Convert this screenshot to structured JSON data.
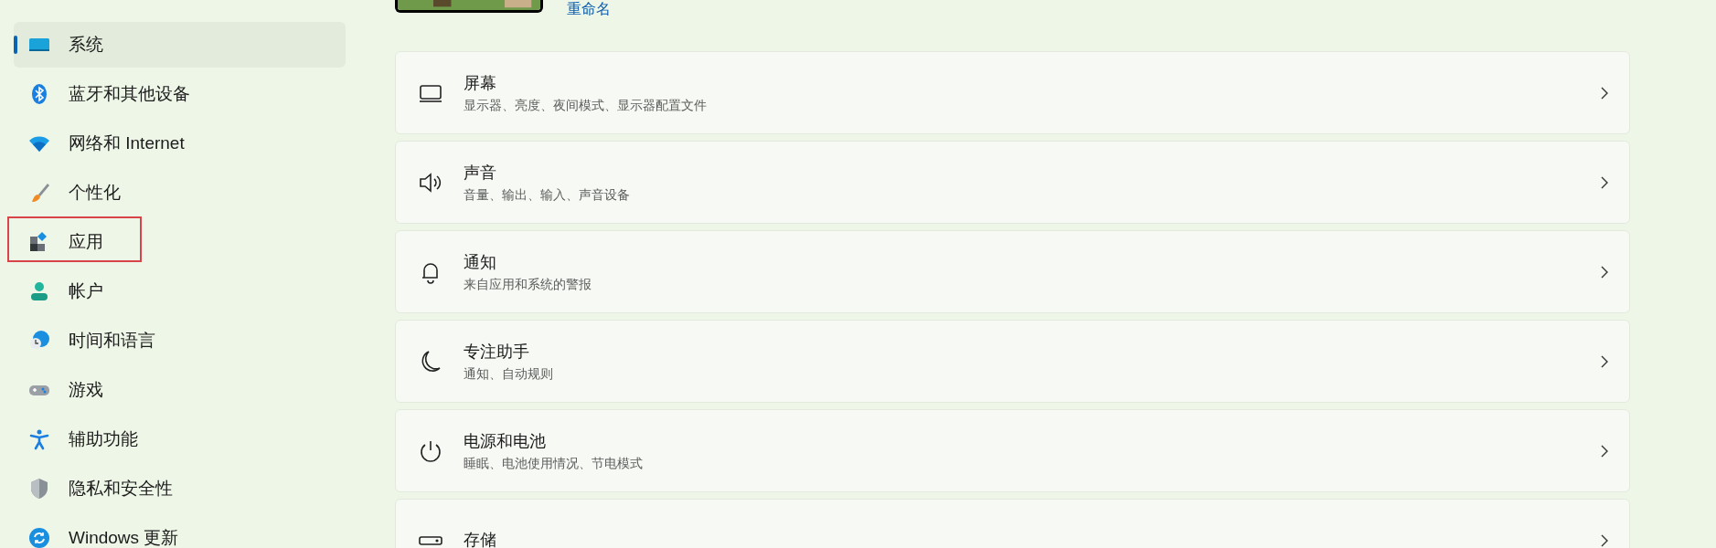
{
  "device": {
    "rename_link": "重命名"
  },
  "sidebar": {
    "items": [
      {
        "label": "系统",
        "kind": "system",
        "selected": true,
        "highlighted": false
      },
      {
        "label": "蓝牙和其他设备",
        "kind": "bluetooth",
        "selected": false,
        "highlighted": false
      },
      {
        "label": "网络和 Internet",
        "kind": "network",
        "selected": false,
        "highlighted": false
      },
      {
        "label": "个性化",
        "kind": "personalize",
        "selected": false,
        "highlighted": false
      },
      {
        "label": "应用",
        "kind": "apps",
        "selected": false,
        "highlighted": true
      },
      {
        "label": "帐户",
        "kind": "account",
        "selected": false,
        "highlighted": false
      },
      {
        "label": "时间和语言",
        "kind": "time",
        "selected": false,
        "highlighted": false
      },
      {
        "label": "游戏",
        "kind": "gaming",
        "selected": false,
        "highlighted": false
      },
      {
        "label": "辅助功能",
        "kind": "accessibility",
        "selected": false,
        "highlighted": false
      },
      {
        "label": "隐私和安全性",
        "kind": "privacy",
        "selected": false,
        "highlighted": false
      },
      {
        "label": "Windows 更新",
        "kind": "update",
        "selected": false,
        "highlighted": false
      }
    ]
  },
  "settings": [
    {
      "kind": "display",
      "title": "屏幕",
      "subtitle": "显示器、亮度、夜间模式、显示器配置文件"
    },
    {
      "kind": "sound",
      "title": "声音",
      "subtitle": "音量、输出、输入、声音设备"
    },
    {
      "kind": "notifications",
      "title": "通知",
      "subtitle": "来自应用和系统的警报"
    },
    {
      "kind": "focus",
      "title": "专注助手",
      "subtitle": "通知、自动规则"
    },
    {
      "kind": "power",
      "title": "电源和电池",
      "subtitle": "睡眠、电池使用情况、节电模式"
    },
    {
      "kind": "storage",
      "title": "存储"
    }
  ]
}
